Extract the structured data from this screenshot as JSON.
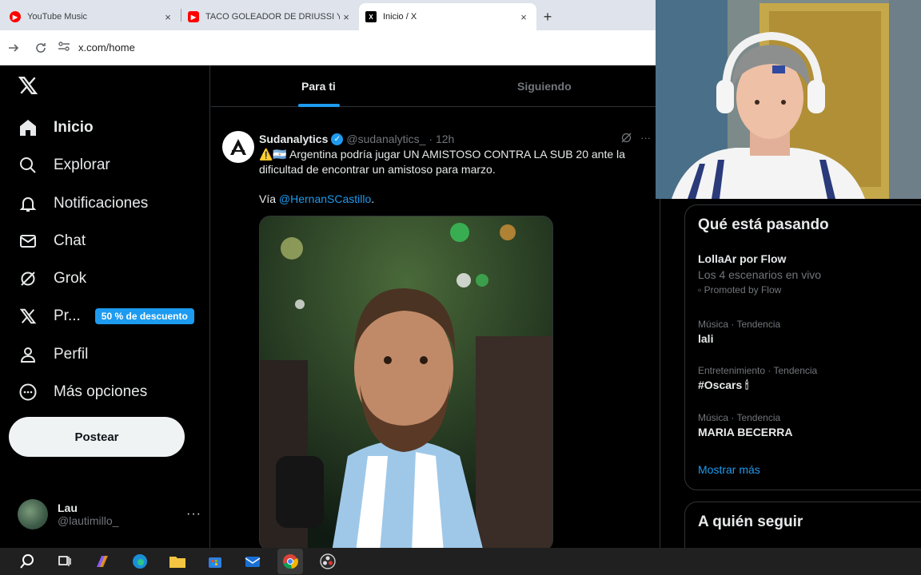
{
  "browser": {
    "tabs": [
      {
        "label": "YouTube Music",
        "favicon": "youtube-music-icon",
        "color": "#ff0000",
        "active": false
      },
      {
        "label": "TACO GOLEADOR DE DRIUSSI Y",
        "favicon": "youtube-icon",
        "color": "#ff0000",
        "active": false
      },
      {
        "label": "Inicio / X",
        "favicon": "x-icon",
        "color": "#000000",
        "active": true
      }
    ],
    "new_tab": "+",
    "close_glyph": "×",
    "url": "x.com/home"
  },
  "sidebar": {
    "items": [
      {
        "label": "Inicio",
        "icon": "home-icon",
        "bold": true
      },
      {
        "label": "Explorar",
        "icon": "search-icon"
      },
      {
        "label": "Notificaciones",
        "icon": "bell-icon"
      },
      {
        "label": "Chat",
        "icon": "mail-icon"
      },
      {
        "label": "Grok",
        "icon": "grok-icon"
      },
      {
        "label": "Pr...",
        "icon": "x-premium-icon",
        "badge": "50 % de descuento"
      },
      {
        "label": "Perfil",
        "icon": "person-icon"
      },
      {
        "label": "Más opciones",
        "icon": "more-circle-icon"
      }
    ],
    "post_button": "Postear",
    "account": {
      "name": "Lau",
      "handle": "@lautimillo_",
      "more": "···"
    }
  },
  "feed": {
    "tabs": [
      {
        "label": "Para ti",
        "active": true
      },
      {
        "label": "Siguiendo",
        "active": false
      }
    ],
    "post": {
      "author": "Sudanalytics",
      "handle": "@sudanalytics_",
      "time": "· 12h",
      "text": "⚠️🇦🇷 Argentina podría jugar UN AMISTOSO CONTRA LA SUB 20 ante la dificultad de encontrar un amistoso para marzo.",
      "via_prefix": "Vía ",
      "mention": "@HernanSCastillo",
      "via_suffix": ".",
      "more": "···"
    }
  },
  "trends": {
    "title": "Qué está pasando",
    "items": [
      {
        "meta": "",
        "name": "LollaAr por Flow",
        "sub": "Los 4 escenarios en vivo",
        "promo": "Promoted by Flow"
      },
      {
        "meta": "Música · Tendencia",
        "name": "lali"
      },
      {
        "meta": "Entretenimiento · Tendencia",
        "name": "#Oscars 🕯"
      },
      {
        "meta": "Música · Tendencia",
        "name": "MARIA BECERRA"
      }
    ],
    "show_more": "Mostrar más"
  },
  "who_to_follow": {
    "title": "A quién seguir"
  },
  "taskbar": {
    "icons": [
      "search-icon",
      "task-view-icon",
      "copilot-icon",
      "edge-icon",
      "file-explorer-icon",
      "store-icon",
      "mail-app-icon",
      "chrome-icon",
      "obs-icon"
    ]
  },
  "colors": {
    "accent": "#1d9bf0",
    "background": "#000000",
    "border": "#2f3336"
  }
}
